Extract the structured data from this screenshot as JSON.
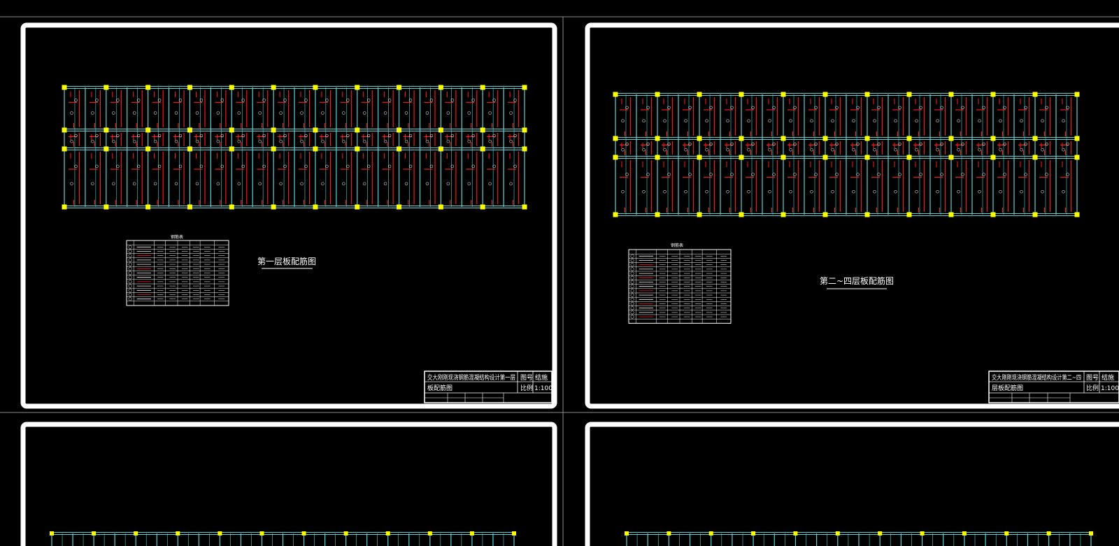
{
  "sheets": [
    {
      "id": "sheet-1",
      "drawing_title": "第一层板配筋图",
      "table_title": "钢筋表",
      "title_block": {
        "project": "交大刚刚现浇钢筋混凝结构设计第一层",
        "drawing": "板配筋图",
        "label_number": "图号",
        "label_scale": "比例",
        "scale": "1:100",
        "number": "结施"
      }
    },
    {
      "id": "sheet-2",
      "drawing_title": "第二~四层板配筋图",
      "table_title": "钢筋表",
      "title_block": {
        "project": "交大刚刚现浇钢筋混凝结构设计第二~四",
        "drawing": "层板配筋图",
        "label_number": "图号",
        "label_scale": "比例",
        "scale": "1:100",
        "number": "结施"
      }
    },
    {
      "id": "sheet-3"
    },
    {
      "id": "sheet-4"
    }
  ],
  "colors": {
    "background": "#000000",
    "sheet_border": "#ffffff",
    "grid": "#5fd3d3",
    "columns": "#ffff00",
    "rebar": "#ff2020",
    "divider": "#8a8a8a"
  }
}
